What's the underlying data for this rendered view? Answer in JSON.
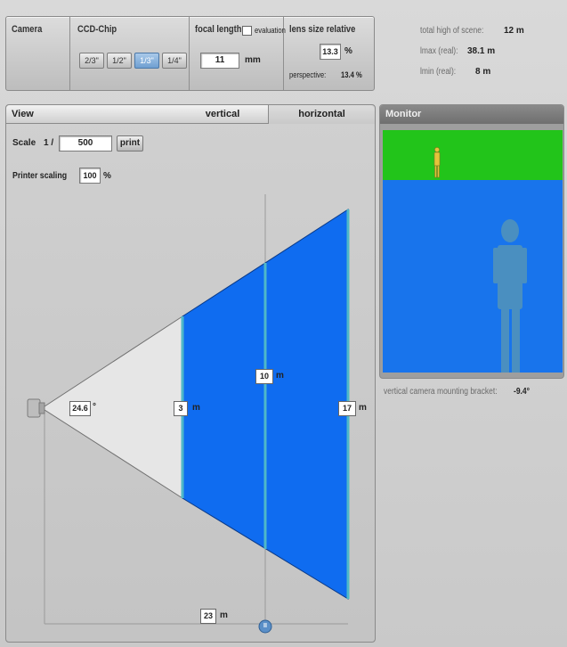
{
  "camera": {
    "label": "Camera"
  },
  "ccd": {
    "label": "CCD-Chip",
    "options": [
      "2/3\"",
      "1/2\"",
      "1/3\"",
      "1/4\""
    ],
    "selected": "1/3\""
  },
  "focal": {
    "label": "focal length",
    "evaluation_label": "evaluation",
    "value": "11",
    "unit": "mm"
  },
  "lens": {
    "label": "lens size relative",
    "value": "13.3",
    "unit": "%",
    "perspective_label": "perspective:",
    "perspective_value": "13.4 %"
  },
  "scene": {
    "total_label": "total high of scene:",
    "total_value": "12 m",
    "lmax_label": "lmax (real):",
    "lmax_value": "38.1 m",
    "lmin_label": "lmin (real):",
    "lmin_value": "8 m"
  },
  "view": {
    "label": "View",
    "tab_vertical": "vertical",
    "tab_horizontal": "horizontal",
    "scale_label": "Scale",
    "scale_prefix": "1 /",
    "scale_value": "500",
    "print_label": "print",
    "printer_scaling_label": "Printer scaling",
    "printer_scaling_value": "100",
    "printer_scaling_unit": "%",
    "angle_value": "24.6",
    "angle_unit": "°",
    "near_width": "3",
    "mid_width": "10",
    "far_width": "17",
    "distance": "23",
    "unit_m": "m",
    "handle_label": "II"
  },
  "monitor": {
    "label": "Monitor",
    "bracket_label": "vertical camera mounting bracket:",
    "bracket_value": "-9.4°"
  },
  "colors": {
    "sky": "#22c41a",
    "ground": "#1874ec",
    "field": "#0f6cf0",
    "person_big": "#4a8fc0",
    "person_small": "#e3c43b"
  }
}
